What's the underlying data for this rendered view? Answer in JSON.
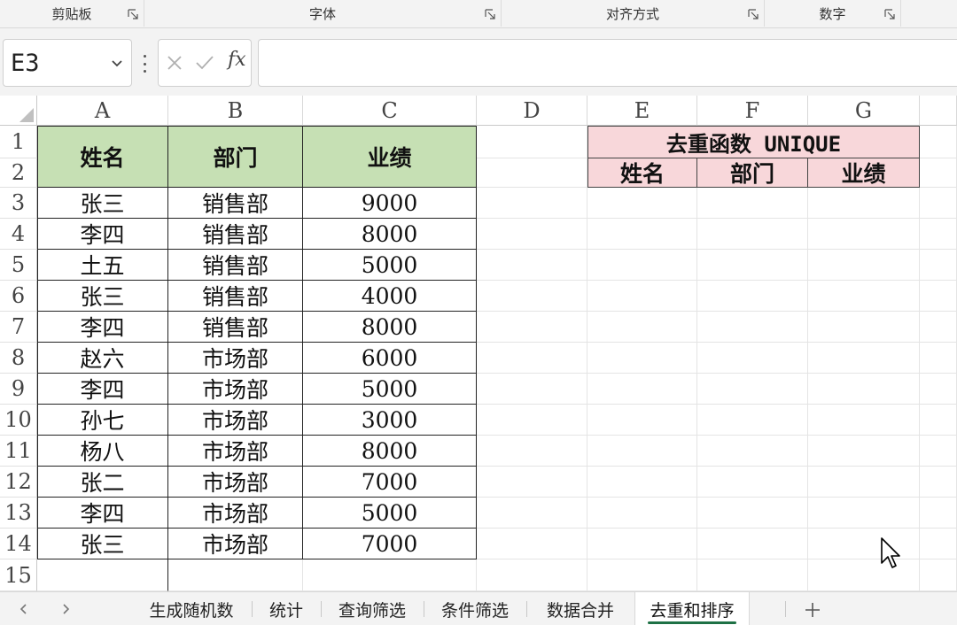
{
  "ribbon": {
    "groups": [
      "剪贴板",
      "字体",
      "对齐方式",
      "数字"
    ]
  },
  "formula_bar": {
    "name_box": "E3",
    "fx_label": "fx",
    "formula": ""
  },
  "sheet": {
    "columns": [
      "A",
      "B",
      "C",
      "D",
      "E",
      "F",
      "G"
    ],
    "rows": [
      "1",
      "2",
      "3",
      "4",
      "5",
      "6",
      "7",
      "8",
      "9",
      "10",
      "11",
      "12",
      "13",
      "14",
      "15"
    ],
    "table": {
      "headers": [
        "姓名",
        "部门",
        "业绩"
      ],
      "rows": [
        [
          "张三",
          "销售部",
          "9000"
        ],
        [
          "李四",
          "销售部",
          "8000"
        ],
        [
          "土五",
          "销售部",
          "5000"
        ],
        [
          "张三",
          "销售部",
          "4000"
        ],
        [
          "李四",
          "销售部",
          "8000"
        ],
        [
          "赵六",
          "市场部",
          "6000"
        ],
        [
          "李四",
          "市场部",
          "5000"
        ],
        [
          "孙七",
          "市场部",
          "3000"
        ],
        [
          "杨八",
          "市场部",
          "8000"
        ],
        [
          "张二",
          "市场部",
          "7000"
        ],
        [
          "李四",
          "市场部",
          "5000"
        ],
        [
          "张三",
          "市场部",
          "7000"
        ]
      ]
    },
    "result": {
      "title": "去重函数 UNIQUE",
      "headers": [
        "姓名",
        "部门",
        "业绩"
      ]
    },
    "colors": {
      "table_header_bg": "#c6e0b4",
      "result_bg": "#f8d7da",
      "active_tab_accent": "#1e7145"
    }
  },
  "tabs": {
    "items": [
      "生成随机数",
      "统计",
      "查询筛选",
      "条件筛选",
      "数据合并",
      "去重和排序"
    ],
    "active": "去重和排序",
    "add_label": "+"
  }
}
